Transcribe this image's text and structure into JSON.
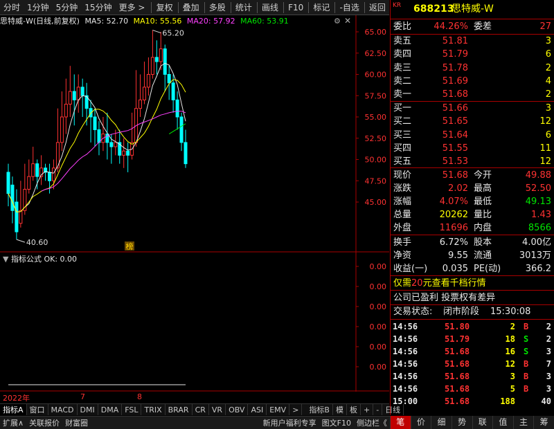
{
  "toolbar": {
    "items": [
      "分时",
      "1分钟",
      "5分钟",
      "15分钟",
      "更多 >",
      "复权",
      "叠加",
      "多股",
      "统计",
      "画线",
      "F10",
      "标记",
      "-自选",
      "返回"
    ]
  },
  "stock": {
    "market": "KR",
    "code": "688213",
    "name": "思特威-W"
  },
  "indicator_bar": {
    "title": "思特威-W(日线,前复权)",
    "ma5": "MA5: 52.70",
    "ma10": "MA10: 55.56",
    "ma20": "MA20: 57.92",
    "ma60": "MA60: 53.91"
  },
  "chart_data": {
    "type": "candlestick",
    "yticks": [
      "65.00",
      "62.50",
      "60.00",
      "57.50",
      "55.00",
      "52.50",
      "50.00",
      "47.50",
      "45.00"
    ],
    "ylim": [
      42.5,
      65.5
    ],
    "high_label": "65.20",
    "low_label": "40.60",
    "marker_label": "榜",
    "sub_title": "指标公式",
    "sub_value": "OK: 0.00",
    "sub_yticks": [
      "0.00",
      "0.00",
      "0.00",
      "0.00",
      "0.00",
      "0.00"
    ],
    "x_labels": [
      "2022年",
      "7",
      "8"
    ],
    "candles": [
      {
        "o": 48.5,
        "c": 46.0,
        "h": 49.5,
        "l": 44.5
      },
      {
        "o": 47.0,
        "c": 44.0,
        "h": 48.0,
        "l": 42.5
      },
      {
        "o": 45.0,
        "c": 41.5,
        "h": 46.5,
        "l": 40.6
      },
      {
        "o": 42.5,
        "c": 44.0,
        "h": 47.5,
        "l": 42.0
      },
      {
        "o": 44.0,
        "c": 46.5,
        "h": 49.5,
        "l": 43.5
      },
      {
        "o": 46.5,
        "c": 48.0,
        "h": 50.0,
        "l": 46.0
      },
      {
        "o": 48.0,
        "c": 49.5,
        "h": 51.5,
        "l": 47.5
      },
      {
        "o": 49.5,
        "c": 48.0,
        "h": 50.0,
        "l": 46.5
      },
      {
        "o": 48.0,
        "c": 49.0,
        "h": 50.5,
        "l": 47.0
      },
      {
        "o": 49.0,
        "c": 48.5,
        "h": 49.5,
        "l": 47.5
      },
      {
        "o": 48.5,
        "c": 47.5,
        "h": 49.5,
        "l": 46.0
      },
      {
        "o": 47.5,
        "c": 49.0,
        "h": 50.0,
        "l": 46.5
      },
      {
        "o": 49.0,
        "c": 52.0,
        "h": 56.0,
        "l": 48.5
      },
      {
        "o": 52.0,
        "c": 55.0,
        "h": 58.0,
        "l": 51.0
      },
      {
        "o": 55.0,
        "c": 56.5,
        "h": 59.5,
        "l": 53.0
      },
      {
        "o": 56.5,
        "c": 58.0,
        "h": 61.0,
        "l": 55.0
      },
      {
        "o": 58.0,
        "c": 57.0,
        "h": 60.0,
        "l": 54.0
      },
      {
        "o": 57.0,
        "c": 58.5,
        "h": 60.0,
        "l": 55.5
      },
      {
        "o": 58.5,
        "c": 57.5,
        "h": 59.5,
        "l": 55.0
      },
      {
        "o": 57.5,
        "c": 56.0,
        "h": 59.0,
        "l": 54.0
      },
      {
        "o": 56.0,
        "c": 55.0,
        "h": 57.0,
        "l": 52.0
      },
      {
        "o": 55.0,
        "c": 53.5,
        "h": 56.0,
        "l": 51.5
      },
      {
        "o": 53.5,
        "c": 52.0,
        "h": 54.5,
        "l": 50.5
      },
      {
        "o": 52.0,
        "c": 53.0,
        "h": 55.0,
        "l": 51.0
      },
      {
        "o": 53.0,
        "c": 52.0,
        "h": 55.5,
        "l": 50.0
      },
      {
        "o": 52.0,
        "c": 51.5,
        "h": 53.0,
        "l": 49.5
      },
      {
        "o": 51.5,
        "c": 52.0,
        "h": 53.5,
        "l": 50.5
      },
      {
        "o": 52.0,
        "c": 50.5,
        "h": 53.5,
        "l": 49.5
      },
      {
        "o": 50.5,
        "c": 51.0,
        "h": 52.5,
        "l": 49.0
      },
      {
        "o": 51.0,
        "c": 50.5,
        "h": 52.0,
        "l": 48.5
      },
      {
        "o": 50.5,
        "c": 52.0,
        "h": 55.5,
        "l": 50.0
      },
      {
        "o": 52.0,
        "c": 56.0,
        "h": 60.5,
        "l": 51.5
      },
      {
        "o": 56.0,
        "c": 57.0,
        "h": 60.0,
        "l": 55.0
      },
      {
        "o": 57.0,
        "c": 58.5,
        "h": 61.5,
        "l": 56.5
      },
      {
        "o": 58.5,
        "c": 60.0,
        "h": 62.0,
        "l": 57.5
      },
      {
        "o": 60.0,
        "c": 62.0,
        "h": 65.2,
        "l": 59.5
      },
      {
        "o": 62.0,
        "c": 61.5,
        "h": 64.0,
        "l": 60.0
      },
      {
        "o": 61.5,
        "c": 63.0,
        "h": 65.0,
        "l": 60.5
      },
      {
        "o": 63.0,
        "c": 60.0,
        "h": 63.5,
        "l": 58.0
      },
      {
        "o": 60.0,
        "c": 59.0,
        "h": 61.0,
        "l": 57.0
      },
      {
        "o": 59.0,
        "c": 57.0,
        "h": 60.0,
        "l": 55.5
      },
      {
        "o": 57.0,
        "c": 55.0,
        "h": 58.0,
        "l": 53.5
      },
      {
        "o": 55.0,
        "c": 52.0,
        "h": 55.5,
        "l": 51.0
      },
      {
        "o": 52.0,
        "c": 49.5,
        "h": 53.5,
        "l": 49.0
      }
    ]
  },
  "orderbook": {
    "weibi_label": "委比",
    "weibi_value": "44.26%",
    "weicha_label": "委差",
    "weicha_value": "27",
    "asks": [
      {
        "label": "卖五",
        "price": "51.81",
        "vol": "3"
      },
      {
        "label": "卖四",
        "price": "51.79",
        "vol": "6"
      },
      {
        "label": "卖三",
        "price": "51.78",
        "vol": "2"
      },
      {
        "label": "卖二",
        "price": "51.69",
        "vol": "4"
      },
      {
        "label": "卖一",
        "price": "51.68",
        "vol": "2"
      }
    ],
    "bids": [
      {
        "label": "买一",
        "price": "51.66",
        "vol": "3"
      },
      {
        "label": "买二",
        "price": "51.65",
        "vol": "12"
      },
      {
        "label": "买三",
        "price": "51.64",
        "vol": "6"
      },
      {
        "label": "买四",
        "price": "51.55",
        "vol": "11"
      },
      {
        "label": "买五",
        "price": "51.53",
        "vol": "12"
      }
    ]
  },
  "quote": {
    "rows": [
      {
        "l1": "现价",
        "v1": "51.68",
        "c1": "red",
        "l2": "今开",
        "v2": "49.88",
        "c2": "red"
      },
      {
        "l1": "涨跌",
        "v1": "2.02",
        "c1": "red",
        "l2": "最高",
        "v2": "52.50",
        "c2": "red"
      },
      {
        "l1": "涨幅",
        "v1": "4.07%",
        "c1": "red",
        "l2": "最低",
        "v2": "49.13",
        "c2": "green"
      },
      {
        "l1": "总量",
        "v1": "20262",
        "c1": "yellow",
        "l2": "量比",
        "v2": "1.43",
        "c2": "red"
      },
      {
        "l1": "外盘",
        "v1": "11696",
        "c1": "red",
        "l2": "内盘",
        "v2": "8566",
        "c2": "green"
      }
    ],
    "rows2": [
      {
        "l1": "换手",
        "v1": "6.72%",
        "l2": "股本",
        "v2": "4.00亿"
      },
      {
        "l1": "净资",
        "v1": "9.55",
        "l2": "流通",
        "v2": "3013万"
      },
      {
        "l1": "收益(一)",
        "v1": "0.035",
        "l2": "PE(动)",
        "v2": "366.2"
      }
    ]
  },
  "notices": {
    "promo_a": "仅需",
    "promo_b": "20",
    "promo_c": "元查看千档行情",
    "line2": "公司已盈利 投票权有差异",
    "status_label": "交易状态:",
    "status_value": "闭市阶段",
    "status_time": "15:30:08"
  },
  "ticks": [
    {
      "t": "14:56",
      "p": "51.80",
      "v": "2",
      "d": "B",
      "n": "2"
    },
    {
      "t": "14:56",
      "p": "51.79",
      "v": "18",
      "d": "S",
      "n": "2"
    },
    {
      "t": "14:56",
      "p": "51.68",
      "v": "16",
      "d": "S",
      "n": "3"
    },
    {
      "t": "14:56",
      "p": "51.68",
      "v": "12",
      "d": "B",
      "n": "7"
    },
    {
      "t": "14:56",
      "p": "51.68",
      "v": "3",
      "d": "B",
      "n": "3"
    },
    {
      "t": "14:56",
      "p": "51.68",
      "v": "5",
      "d": "B",
      "n": "3"
    },
    {
      "t": "15:00",
      "p": "51.68",
      "v": "188",
      "d": "",
      "n": "40"
    }
  ],
  "tabs": [
    "指标A",
    "窗口",
    "MACD",
    "DMI",
    "DMA",
    "FSL",
    "TRIX",
    "BRAR",
    "CR",
    "VR",
    "OBV",
    "ASI",
    "EMV",
    ">",
    "指标B",
    "模",
    "板",
    "+",
    "-",
    "日线"
  ],
  "statusbar": [
    "扩展∧",
    "关联报价",
    "财富圈",
    "新用户福利专享",
    "图文F10",
    "侧边栏《"
  ],
  "rtabs": [
    "笔",
    "价",
    "细",
    "势",
    "联",
    "值",
    "主",
    "筹"
  ]
}
